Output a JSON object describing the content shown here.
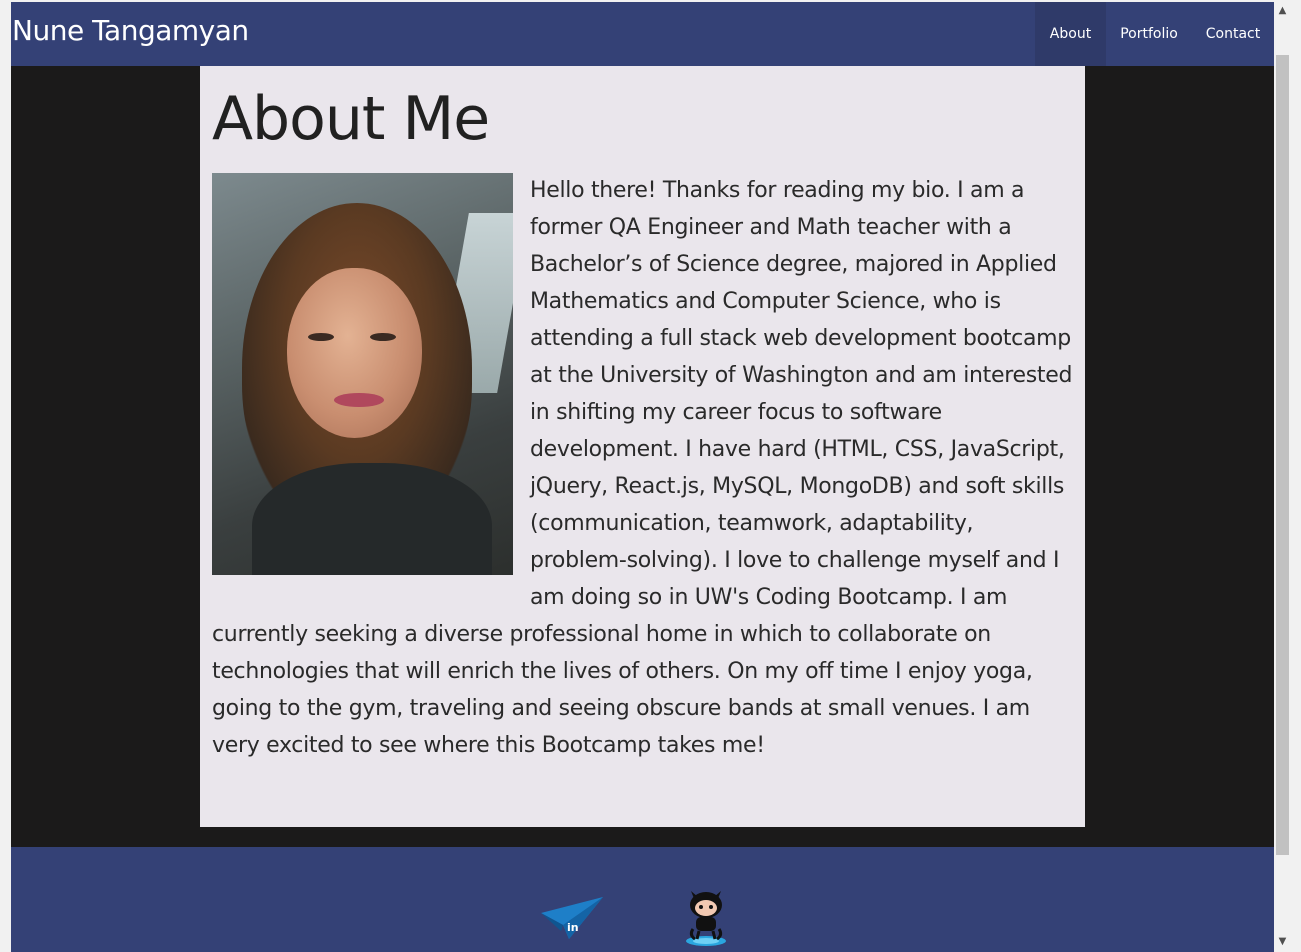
{
  "header": {
    "brand": "Nune Tangamyan",
    "nav": [
      {
        "label": "About",
        "active": true
      },
      {
        "label": "Portfolio",
        "active": false
      },
      {
        "label": "Contact",
        "active": false
      }
    ]
  },
  "about": {
    "title": "About Me",
    "bio": "Hello there! Thanks for reading my bio. I am a former QA Engineer and Math teacher with a Bachelor’s of Science degree, majored in Applied Mathematics and Computer Science, who is attending a full stack web development bootcamp at the University of Washington and am interested in shifting my career focus to software development. I have hard (HTML, CSS, JavaScript, jQuery, React.js, MySQL, MongoDB) and soft skills (communication, teamwork, adaptability, problem-solving). I love to challenge myself and I am doing so in UW's Coding Bootcamp. I am currently seeking a diverse professional home in which to collaborate on technologies that will enrich the lives of others. On my off time I enjoy yoga, going to the gym, traveling and seeing obscure bands at small venues. I am very excited to see where this Bootcamp takes me!"
  },
  "footer": {
    "linkedin_badge": "in",
    "icons": [
      "linkedin-icon",
      "github-icon"
    ]
  },
  "colors": {
    "navbar": "#344176",
    "nav_active": "#2f3a69",
    "page_background": "#1b1a1a",
    "card_background": "#eae6ec",
    "footer": "#344176"
  },
  "scrollbar": {
    "up_glyph": "▲",
    "down_glyph": "▼"
  }
}
